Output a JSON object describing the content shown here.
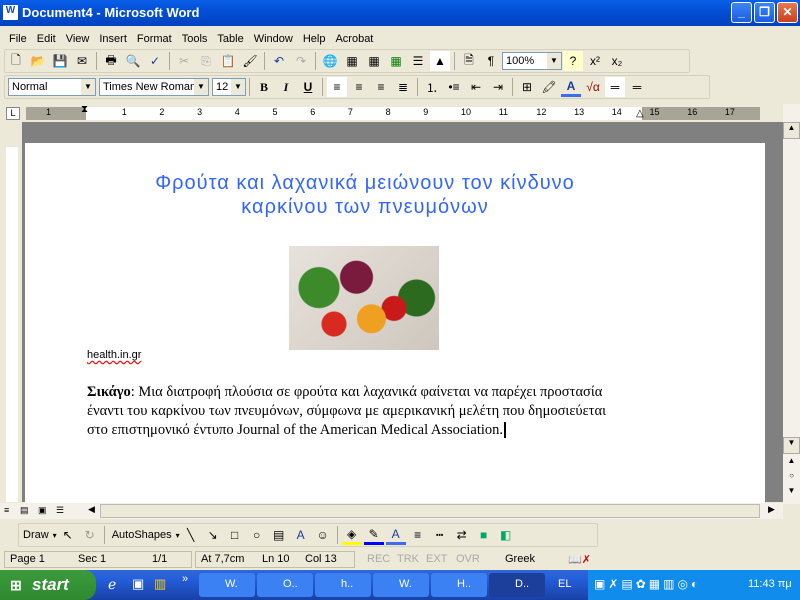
{
  "window": {
    "title": "Document4 - Microsoft Word"
  },
  "menu": [
    "File",
    "Edit",
    "View",
    "Insert",
    "Format",
    "Tools",
    "Table",
    "Window",
    "Help",
    "Acrobat"
  ],
  "toolbar": {
    "zoom": "100%",
    "style": "Normal",
    "font": "Times New Roman",
    "size": "12"
  },
  "ruler": {
    "labels": [
      "1",
      "1",
      "2",
      "3",
      "4",
      "5",
      "6",
      "7",
      "8",
      "9",
      "10",
      "11",
      "12",
      "13",
      "14",
      "15",
      "16",
      "17"
    ]
  },
  "document": {
    "title_line1": "Φρούτα και λαχανικά μειώνουν τον κίνδυνο",
    "title_line2": "καρκίνου των πνευμόνων",
    "source": "health.in.gr",
    "bold_lead": "Σικάγο",
    "body": ": Μια διατροφή πλούσια σε φρούτα και λαχανικά φαίνεται να παρέχει προστασία έναντι του καρκίνου των πνευμόνων, σύμφωνα με αμερικανική μελέτη που δημοσιεύεται στο επιστημονικό έντυπο Journal of the American Medical Association.",
    "title_color": "#3366ff"
  },
  "drawing": {
    "draw": "Draw",
    "autoshapes": "AutoShapes"
  },
  "status": {
    "page": "Page 1",
    "sec": "Sec 1",
    "pages": "1/1",
    "at": "At 7,7cm",
    "ln": "Ln 10",
    "col": "Col 13",
    "rec": "REC",
    "trk": "TRK",
    "ext": "EXT",
    "ovr": "OVR",
    "lang": "Greek"
  },
  "taskbar": {
    "start": "start",
    "tasks": [
      "W.",
      "O..",
      "h..",
      "W.",
      "H..",
      "D.."
    ],
    "lang": "EL",
    "clock": "11:43 πμ"
  }
}
